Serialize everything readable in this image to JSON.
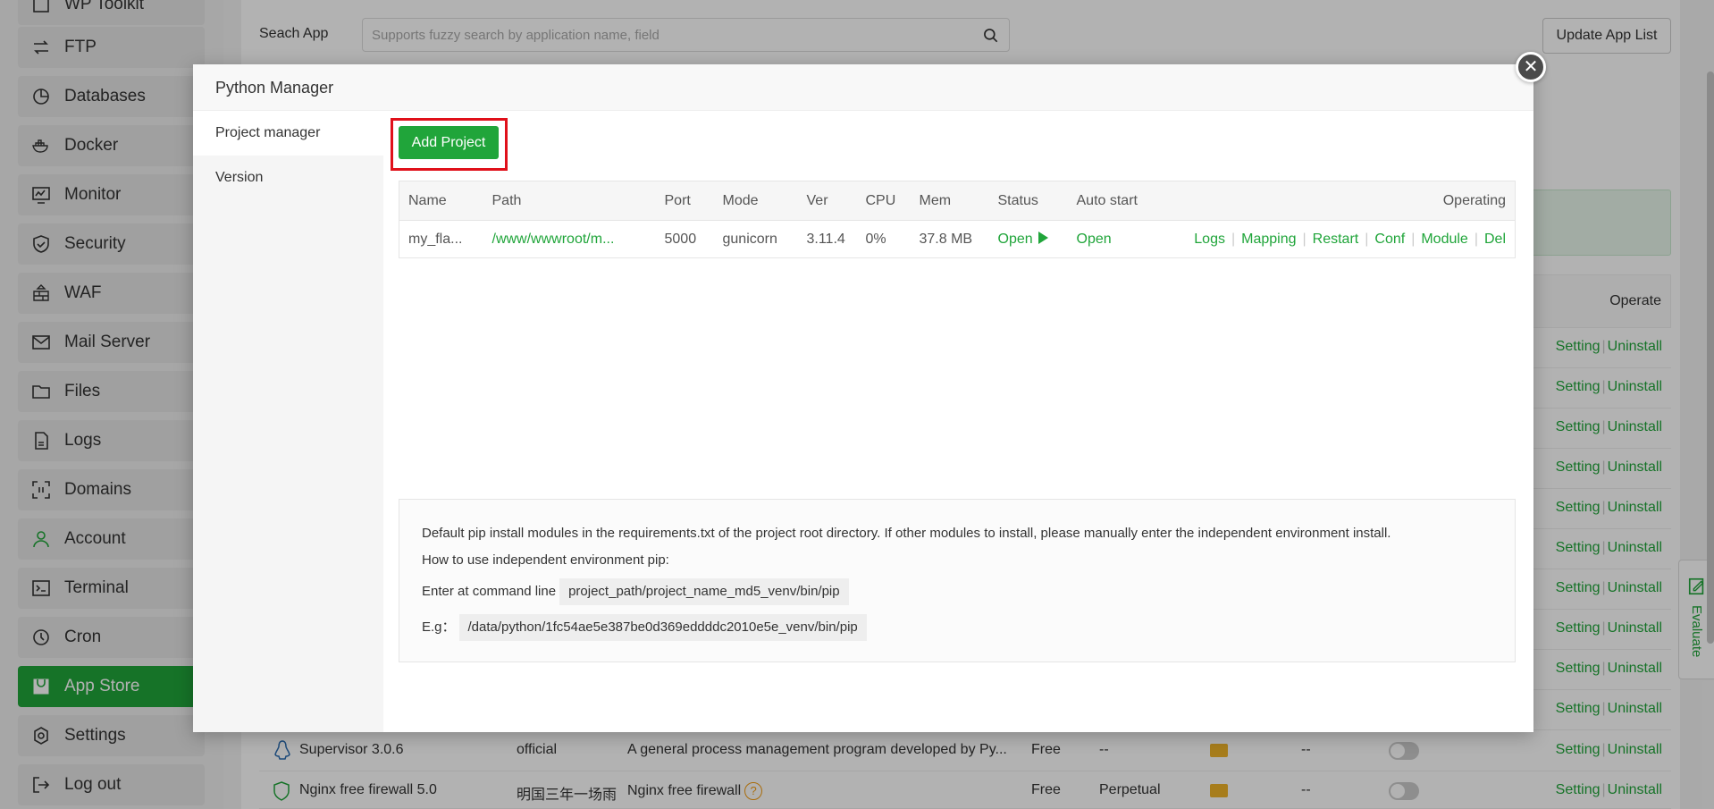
{
  "sidebar": {
    "items": [
      {
        "label": "WP Toolkit",
        "icon": "wordpress-icon",
        "active": false
      },
      {
        "label": "FTP",
        "icon": "ftp-icon",
        "active": false
      },
      {
        "label": "Databases",
        "icon": "database-icon",
        "active": false
      },
      {
        "label": "Docker",
        "icon": "docker-icon",
        "active": false
      },
      {
        "label": "Monitor",
        "icon": "monitor-icon",
        "active": false
      },
      {
        "label": "Security",
        "icon": "shield-icon",
        "active": false
      },
      {
        "label": "WAF",
        "icon": "firewall-icon",
        "active": false
      },
      {
        "label": "Mail Server",
        "icon": "mail-icon",
        "active": false
      },
      {
        "label": "Files",
        "icon": "folder-icon",
        "active": false
      },
      {
        "label": "Logs",
        "icon": "logs-icon",
        "active": false
      },
      {
        "label": "Domains",
        "icon": "domains-icon",
        "active": false
      },
      {
        "label": "Account",
        "icon": "user-icon",
        "active": false
      },
      {
        "label": "Terminal",
        "icon": "terminal-icon",
        "active": false
      },
      {
        "label": "Cron",
        "icon": "clock-icon",
        "active": false
      },
      {
        "label": "App Store",
        "icon": "store-icon",
        "active": true
      },
      {
        "label": "Settings",
        "icon": "gear-icon",
        "active": false
      },
      {
        "label": "Log out",
        "icon": "logout-icon",
        "active": false
      }
    ]
  },
  "appstore": {
    "search_label": "Seach App",
    "search_placeholder": "Supports fuzzy search by application name, field",
    "update_button": "Update App List",
    "operate_header": "Operate",
    "setting_label": "Setting",
    "uninstall_label": "Uninstall",
    "rows": [
      {
        "name": "Supervisor 3.0.6",
        "developer": "official",
        "description": "A general process management program developed by Py...",
        "price": "Free",
        "expire": "--",
        "extra": "--"
      },
      {
        "name": "Nginx free firewall 5.0",
        "developer": "明国三年一场雨",
        "description": "Nginx free firewall",
        "price": "Free",
        "expire": "Perpetual",
        "extra": "--"
      }
    ],
    "help_glyph": "?"
  },
  "evaluate": {
    "label": "Evaluate"
  },
  "modal": {
    "title": "Python Manager",
    "close_glyph": "✕",
    "nav": [
      {
        "label": "Project manager",
        "active": true
      },
      {
        "label": "Version",
        "active": false
      }
    ],
    "add_button": "Add Project",
    "table": {
      "headers": [
        "Name",
        "Path",
        "Port",
        "Mode",
        "Ver",
        "CPU",
        "Mem",
        "Status",
        "Auto start",
        "Operating"
      ],
      "rows": [
        {
          "name": "my_fla...",
          "path": "/www/wwwroot/m...",
          "port": "5000",
          "mode": "gunicorn",
          "ver": "3.11.4",
          "cpu": "0%",
          "mem": "37.8 MB",
          "status": "Open",
          "auto_start": "Open"
        }
      ],
      "operations": [
        "Logs",
        "Mapping",
        "Restart",
        "Conf",
        "Module",
        "Del"
      ],
      "separator": "|"
    },
    "info": {
      "line1": "Default pip install modules in the requirements.txt of the project root directory. If other modules to install, please manually enter the independent environment install.",
      "line2": "How to use independent environment pip:",
      "line3_label": "Enter at command line",
      "line3_code": "project_path/project_name_md5_venv/bin/pip",
      "line4_label": "E.g：",
      "line4_code": "/data/python/1fc54ae5e387be0d369eddddc2010e5e_venv/bin/pip"
    }
  },
  "colors": {
    "accent": "#20a53a",
    "highlight": "#e0101a"
  }
}
